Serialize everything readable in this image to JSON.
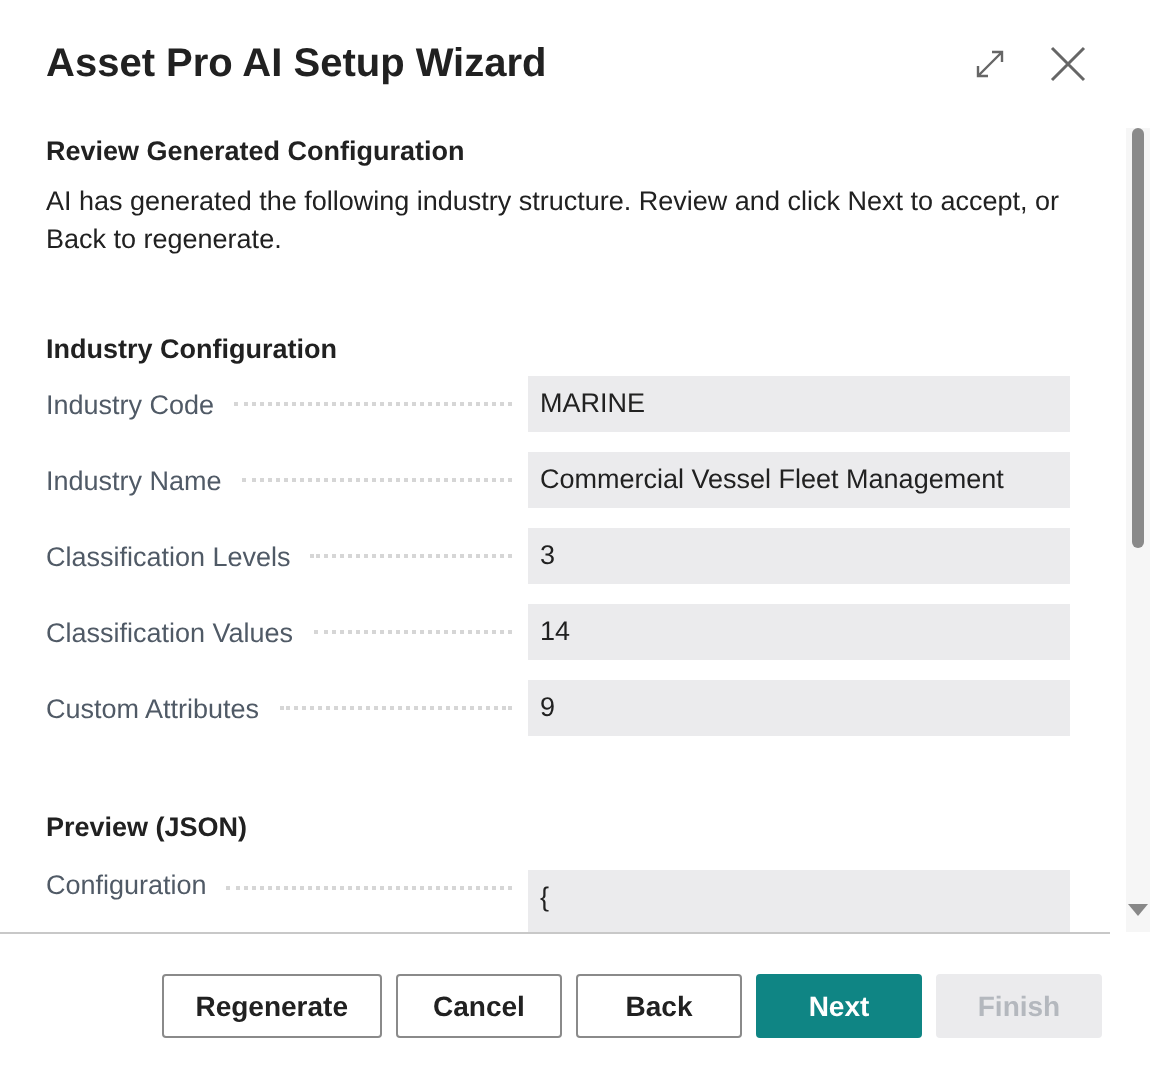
{
  "window": {
    "title": "Asset Pro AI Setup Wizard"
  },
  "step": {
    "heading": "Review Generated Configuration",
    "description": "AI has generated the following industry structure. Review and click Next to accept, or Back to regenerate."
  },
  "sections": [
    {
      "title": "Industry Configuration",
      "fields": [
        {
          "label": "Industry Code",
          "value": "MARINE"
        },
        {
          "label": "Industry Name",
          "value": "Commercial Vessel Fleet Management"
        },
        {
          "label": "Classification Levels",
          "value": "3"
        },
        {
          "label": "Classification Values",
          "value": "14"
        },
        {
          "label": "Custom Attributes",
          "value": "9"
        }
      ]
    },
    {
      "title": "Preview (JSON)",
      "fields": [
        {
          "label": "Configuration",
          "value": "{",
          "kind": "multiline"
        }
      ]
    }
  ],
  "buttons": [
    {
      "label": "Regenerate",
      "primary": false,
      "disabled": false
    },
    {
      "label": "Cancel",
      "primary": false,
      "disabled": false
    },
    {
      "label": "Back",
      "primary": false,
      "disabled": false
    },
    {
      "label": "Next",
      "primary": true,
      "disabled": false
    },
    {
      "label": "Finish",
      "primary": false,
      "disabled": true
    }
  ]
}
